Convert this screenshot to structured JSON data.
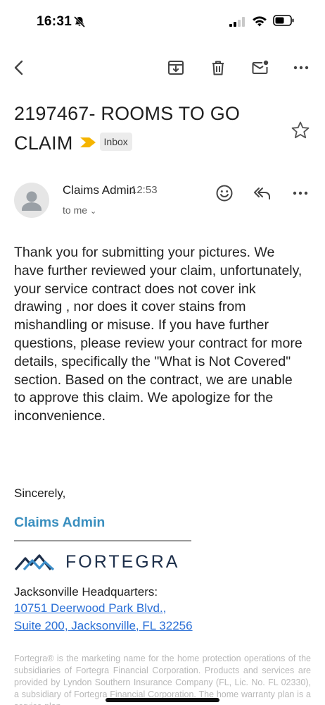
{
  "status_bar": {
    "time": "16:31"
  },
  "toolbar": {
    "back": "back-arrow-icon",
    "archive": "archive-icon",
    "delete": "trash-icon",
    "mark_unread": "mark-unread-icon",
    "more": "more-horizontal-icon"
  },
  "email": {
    "subject_line1": "2197467- ROOMS TO GO",
    "subject_line2": "CLAIM",
    "label": "Inbox",
    "sender": {
      "name": "Claims Admin",
      "time": "12:53",
      "recipient": "to me"
    },
    "body": "Thank you for submitting your pictures. We have further reviewed your claim, unfortunately, your service contract does not cover ink drawing , nor does it cover stains from mishandling or misuse. If you have further questions, please review your contract for more details, specifically the \"What is Not Covered\" section. Based on the contract, we are unable to approve this claim. We apologize for the inconvenience.",
    "signature": {
      "closing": "Sincerely,",
      "name": "Claims Admin",
      "company_logo_text": "FORTEGRA",
      "hq_label": "Jacksonville Headquarters:",
      "address_line1": "10751 Deerwood Park Blvd.,",
      "address_line2": "Suite 200, Jacksonville, FL 32256"
    },
    "footer": "Fortegra® is the marketing name for the home protection operations of the subsidiaries of Fortegra Financial Corporation. Products and services are provided by Lyndon Southern Insurance Company (FL, Lic. No. FL 02330), a subsidiary of Fortegra Financial Corporation. The home warranty plan is a service plan"
  },
  "colors": {
    "accent_blue": "#3a8fbf",
    "link_blue": "#2a6fd6",
    "importance_yellow": "#f5b400",
    "logo_navy": "#1d2f4a",
    "logo_blue": "#3d8ec9"
  }
}
